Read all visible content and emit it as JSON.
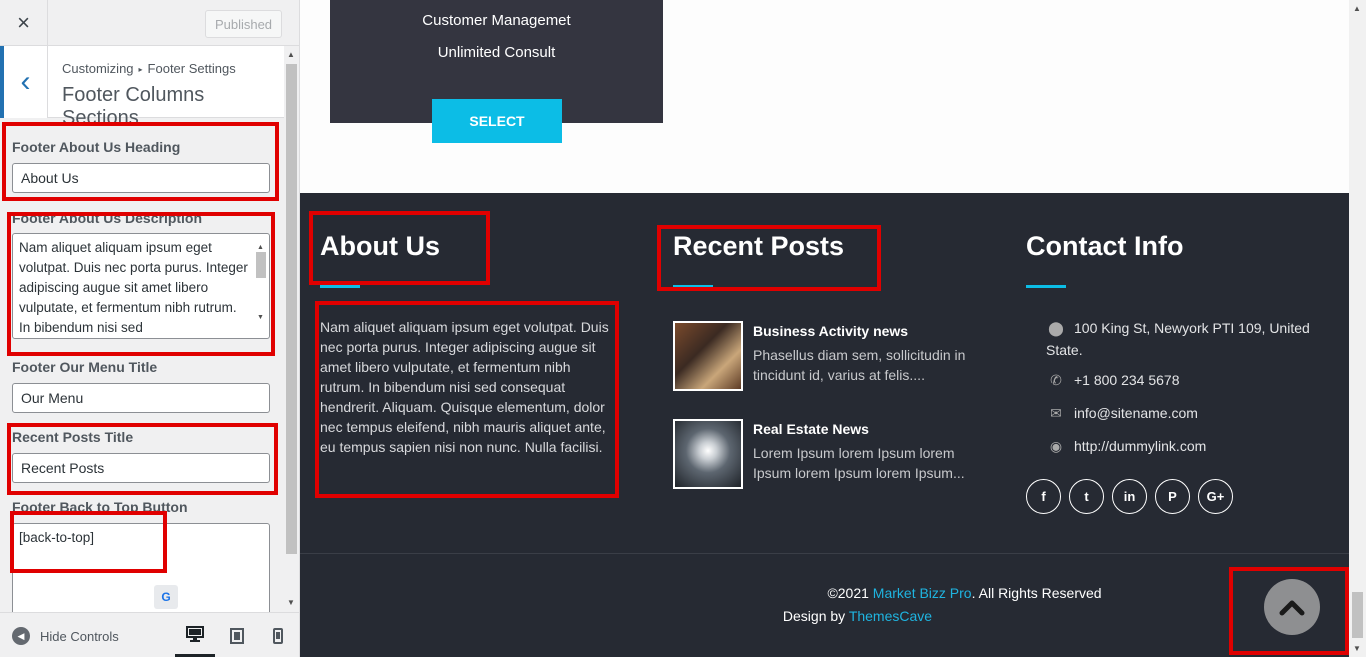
{
  "customizer": {
    "close_icon": "×",
    "publish_label": "Published",
    "breadcrumb_root": "Customizing",
    "breadcrumb_arrow": "▸",
    "breadcrumb_section": "Footer Settings",
    "section_title": "Footer Columns Sections",
    "back_icon": "‹",
    "fields": {
      "about_heading_label": "Footer About Us Heading",
      "about_heading_value": "About Us",
      "about_desc_label": "Footer About Us Description",
      "about_desc_value": "Nam aliquet aliquam ipsum eget volutpat. Duis nec porta purus. Integer adipiscing augue sit amet libero vulputate, et fermentum nibh rutrum. In bibendum nisi sed",
      "menu_title_label": "Footer Our Menu Title",
      "menu_title_value": "Our Menu",
      "recent_posts_label": "Recent Posts Title",
      "recent_posts_value": "Recent Posts",
      "back_to_top_label": "Footer Back to Top Button",
      "back_to_top_value": "[back-to-top]"
    },
    "hide_controls_label": "Hide Controls"
  },
  "pricing": {
    "features": [
      "Customer Managemet",
      "Unlimited Consult"
    ],
    "select_label": "SELECT"
  },
  "footer": {
    "about": {
      "heading": "About Us",
      "text": "Nam aliquet aliquam ipsum eget volutpat. Duis nec porta purus. Integer adipiscing augue sit amet libero vulputate, et fermentum nibh rutrum. In bibendum nisi sed consequat hendrerit. Aliquam. Quisque elementum, dolor nec tempus eleifend, nibh mauris aliquet ante, eu tempus sapien nisi non nunc. Nulla facilisi."
    },
    "recent_posts": {
      "heading": "Recent Posts",
      "posts": [
        {
          "title": "Business Activity news",
          "excerpt": "Phasellus diam sem, sollicitudin in tincidunt id, varius at felis...."
        },
        {
          "title": "Real Estate News",
          "excerpt": "Lorem Ipsum lorem Ipsum lorem Ipsum lorem Ipsum lorem Ipsum..."
        }
      ]
    },
    "contact": {
      "heading": "Contact Info",
      "address": "100 King St, Newyork PTI 109, United State.",
      "phone": "+1 800 234 5678",
      "email": "info@sitename.com",
      "website": "http://dummylink.com"
    },
    "social_icons": [
      "facebook-icon",
      "twitter-icon",
      "linkedin-icon",
      "pinterest-icon",
      "google-plus-icon"
    ],
    "copyright_prefix": "©2021 ",
    "copyright_brand": "Market Bizz Pro",
    "copyright_suffix": ". All Rights Reserved",
    "design_prefix": "Design by ",
    "design_brand": "ThemesCave"
  },
  "colors": {
    "accent": "#0cbde6",
    "footer_bg": "#262a33",
    "highlight": "#e00000",
    "wp_blue": "#2271b1"
  }
}
